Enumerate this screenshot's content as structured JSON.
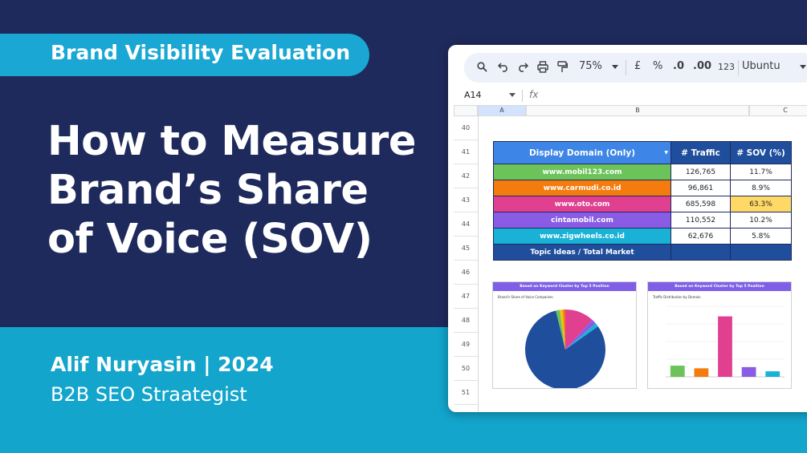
{
  "banner": {
    "tag": "Brand Visibility Evaluation",
    "headline": [
      "How to Measure",
      "Brand’s Share",
      "of Voice (SOV)"
    ],
    "author": "Alif Nuryasin | 2024",
    "role": "B2B SEO Straategist"
  },
  "spreadsheet": {
    "toolbar": {
      "zoom": "75%",
      "currency": "£",
      "percent": "%",
      "decrease_decimal": ".0",
      "increase_decimal": ".00",
      "number_format": "123",
      "font": "Ubuntu"
    },
    "formula_bar": {
      "cell_ref": "A14",
      "fx": "fx"
    },
    "columns": [
      "A",
      "B",
      "C"
    ],
    "rows": [
      "40",
      "41",
      "42",
      "43",
      "44",
      "45",
      "46",
      "47",
      "48",
      "49",
      "50",
      "51"
    ],
    "table": {
      "headers": [
        "Display Domain (Only)",
        "# Traffic",
        "# SOV (%)"
      ],
      "rows": [
        {
          "domain": "www.mobil123.com",
          "traffic": "126,765",
          "sov": "11.7%",
          "color": "#6cc35a"
        },
        {
          "domain": "www.carmudi.co.id",
          "traffic": "96,861",
          "sov": "8.9%",
          "color": "#f47b0e"
        },
        {
          "domain": "www.oto.com",
          "traffic": "685,598",
          "sov": "63.3%",
          "color": "#e0408f",
          "highlight": "#ffd966"
        },
        {
          "domain": "cintamobil.com",
          "traffic": "110,552",
          "sov": "10.2%",
          "color": "#8a5ce6"
        },
        {
          "domain": "www.zigwheels.co.id",
          "traffic": "62,676",
          "sov": "5.8%",
          "color": "#19b2d6"
        }
      ],
      "footer": "Topic Ideas / Total Market"
    },
    "charts": [
      {
        "header": "Based on Keyword Cluster by Top 5 Position",
        "subtitle": "Brand's Share of Voice Companies",
        "type": "pie",
        "slices": [
          {
            "value": 11.7,
            "color": "#e0408f"
          },
          {
            "value": 2.0,
            "color": "#8a5ce6"
          },
          {
            "value": 1.5,
            "color": "#19b2d6"
          },
          {
            "value": 81.0,
            "color": "#1f4e9c"
          },
          {
            "value": 1.6,
            "color": "#6cc35a"
          },
          {
            "value": 1.2,
            "color": "#f4c20e"
          },
          {
            "value": 1.0,
            "color": "#f47b0e"
          }
        ]
      },
      {
        "header": "Based on Keyword Cluster by Top 5 Position",
        "subtitle": "Traffic Distribution by Domain",
        "type": "bar",
        "values": [
          126765,
          96861,
          685598,
          110552,
          62676
        ],
        "colors": [
          "#6cc35a",
          "#f47b0e",
          "#e0408f",
          "#8a5ce6",
          "#19b2d6"
        ],
        "ymax": 800000
      }
    ]
  }
}
